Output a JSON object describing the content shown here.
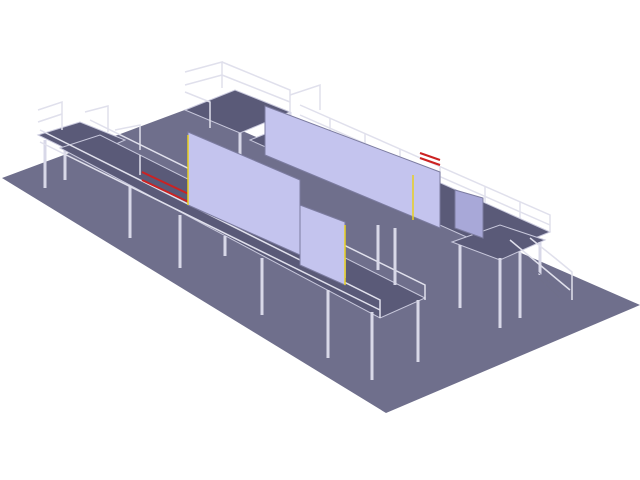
{
  "scene": {
    "colors": {
      "background": "#ffffff",
      "floor": "#6f6f8c",
      "panel": "#c4c4ee",
      "steel": "#d8d8e8",
      "accent_red": "#cc2222",
      "accent_yellow": "#e8d020"
    }
  }
}
